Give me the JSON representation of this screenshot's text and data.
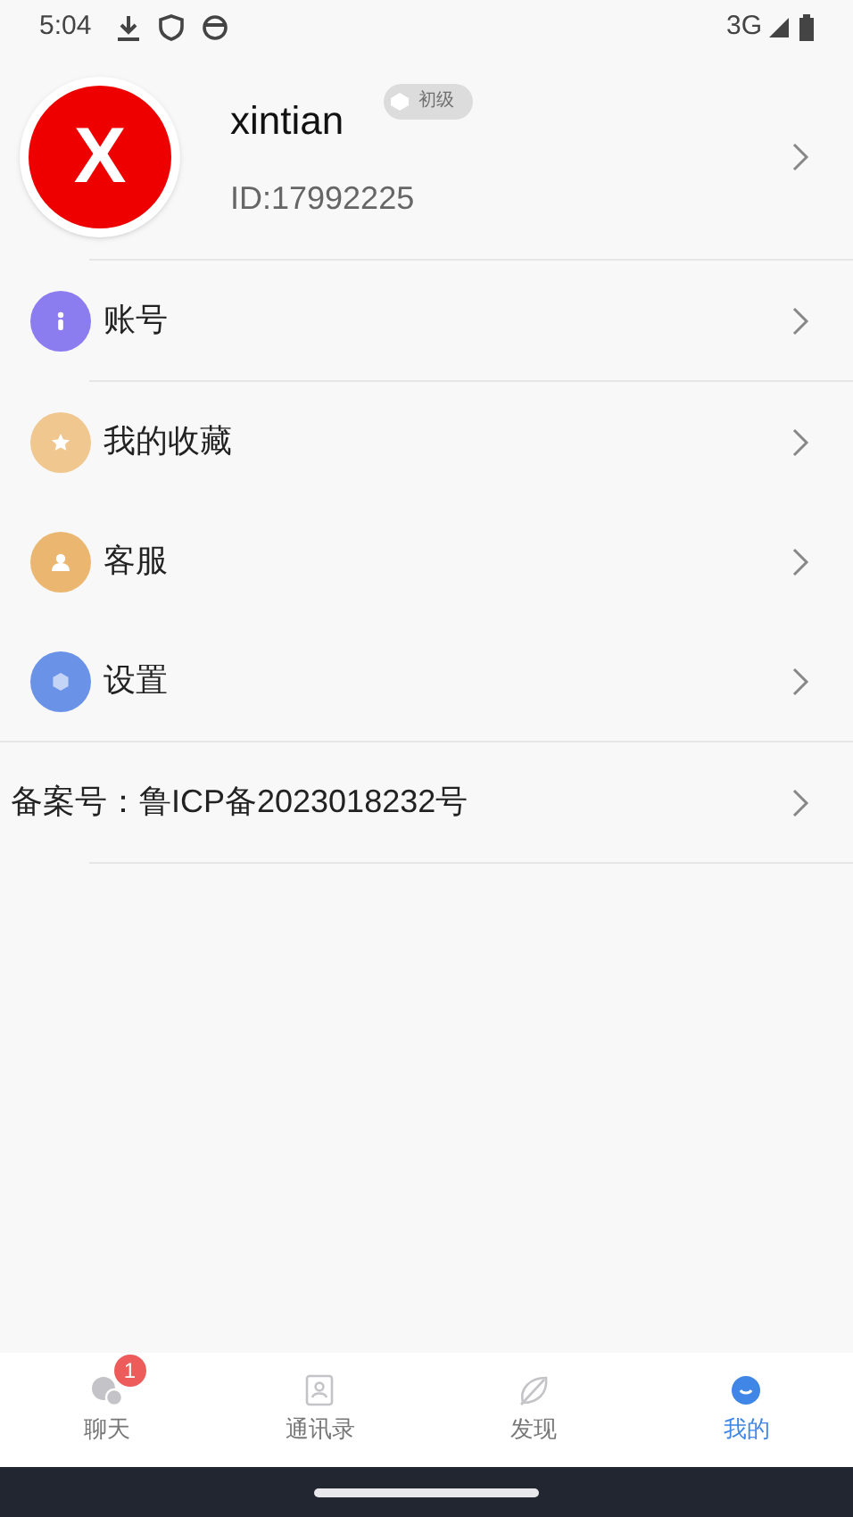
{
  "status_bar": {
    "time": "5:04",
    "network": "3G"
  },
  "profile": {
    "name": "xintian",
    "level_badge": "初级",
    "id": "ID:17992225",
    "avatar_letter": "X"
  },
  "menu": [
    {
      "label": "账号",
      "kind": "info",
      "color": "#8b7cf0"
    },
    {
      "label": "我的收藏",
      "kind": "star",
      "color": "#f0c78e"
    },
    {
      "label": "客服",
      "kind": "person",
      "color": "#ebb66f"
    },
    {
      "label": "设置",
      "kind": "gear",
      "color": "#6a93e8"
    }
  ],
  "filing": "备案号：鲁ICP备2023018232号",
  "tabs": [
    {
      "label": "聊天",
      "kind": "chat",
      "selected": false,
      "badge": "1"
    },
    {
      "label": "通讯录",
      "kind": "contacts",
      "selected": false
    },
    {
      "label": "发现",
      "kind": "discover",
      "selected": false
    },
    {
      "label": "我的",
      "kind": "me",
      "selected": true
    }
  ]
}
